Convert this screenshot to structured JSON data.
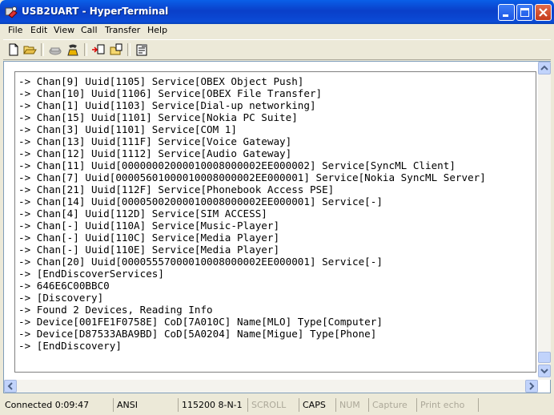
{
  "window": {
    "title": "USB2UART - HyperTerminal",
    "icon": "hyperterminal-icon",
    "controls": {
      "minimize": "minimize-icon",
      "maximize": "maximize-icon",
      "close": "close-icon"
    }
  },
  "menu": [
    "File",
    "Edit",
    "View",
    "Call",
    "Transfer",
    "Help"
  ],
  "toolbar": [
    "new-document-icon",
    "open-folder-icon",
    "disconnect-icon",
    "dial-icon",
    "send-file-icon",
    "receive-file-icon",
    "properties-icon"
  ],
  "terminal": {
    "lines": [
      "-> Chan[9] Uuid[1105] Service[OBEX Object Push]",
      "-> Chan[10] Uuid[1106] Service[OBEX File Transfer]",
      "-> Chan[1] Uuid[1103] Service[Dial-up networking]",
      "-> Chan[15] Uuid[1101] Service[Nokia PC Suite]",
      "-> Chan[3] Uuid[1101] Service[COM 1]",
      "-> Chan[13] Uuid[111F] Service[Voice Gateway]",
      "-> Chan[12] Uuid[1112] Service[Audio Gateway]",
      "-> Chan[11] Uuid[00000002000010008000002EE000002] Service[SyncML Client]",
      "-> Chan[7] Uuid[00005601000010008000002EE000001] Service[Nokia SyncML Server]",
      "-> Chan[21] Uuid[112F] Service[Phonebook Access PSE]",
      "-> Chan[14] Uuid[00005002000010008000002EE000001] Service[-]",
      "-> Chan[4] Uuid[112D] Service[SIM ACCESS]",
      "-> Chan[-] Uuid[110A] Service[Music-Player]",
      "-> Chan[-] Uuid[110C] Service[Media Player]",
      "-> Chan[-] Uuid[110E] Service[Media Player]",
      "-> Chan[20] Uuid[00005557000010008000002EE000001] Service[-]",
      "-> [EndDiscoverServices]",
      "-> 646E6C00BBC0",
      "-> [Discovery]",
      "-> Found 2 Devices, Reading Info",
      "-> Device[001FE1F0758E] CoD[7A010C] Name[MLO] Type[Computer]",
      "-> Device[D87533ABA9BD] CoD[5A0204] Name[Migue] Type[Phone]",
      "-> [EndDiscovery]"
    ]
  },
  "status": {
    "connected": "Connected 0:09:47",
    "emulation": "ANSI",
    "port_settings": "115200 8-N-1",
    "scroll": "SCROLL",
    "caps": "CAPS",
    "num": "NUM",
    "capture": "Capture",
    "print_echo": "Print echo"
  },
  "colors": {
    "titlebar": "#0a3fc9",
    "background": "#ece9d8",
    "terminal_bg": "#ffffff",
    "dimmed_text": "#aca899"
  }
}
